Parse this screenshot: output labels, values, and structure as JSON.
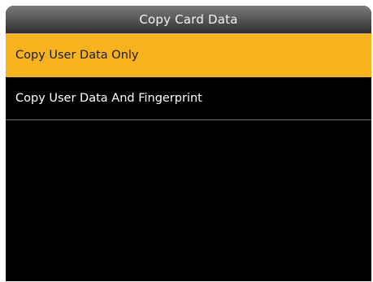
{
  "screen": {
    "title": "Copy Card Data"
  },
  "menu": {
    "items": [
      {
        "label": "Copy User Data Only",
        "selected": true
      },
      {
        "label": "Copy User Data And Fingerprint",
        "selected": false
      }
    ]
  },
  "colors": {
    "highlight": "#f7b31e",
    "background": "#000000",
    "title_bar": "#5a5a5a"
  }
}
